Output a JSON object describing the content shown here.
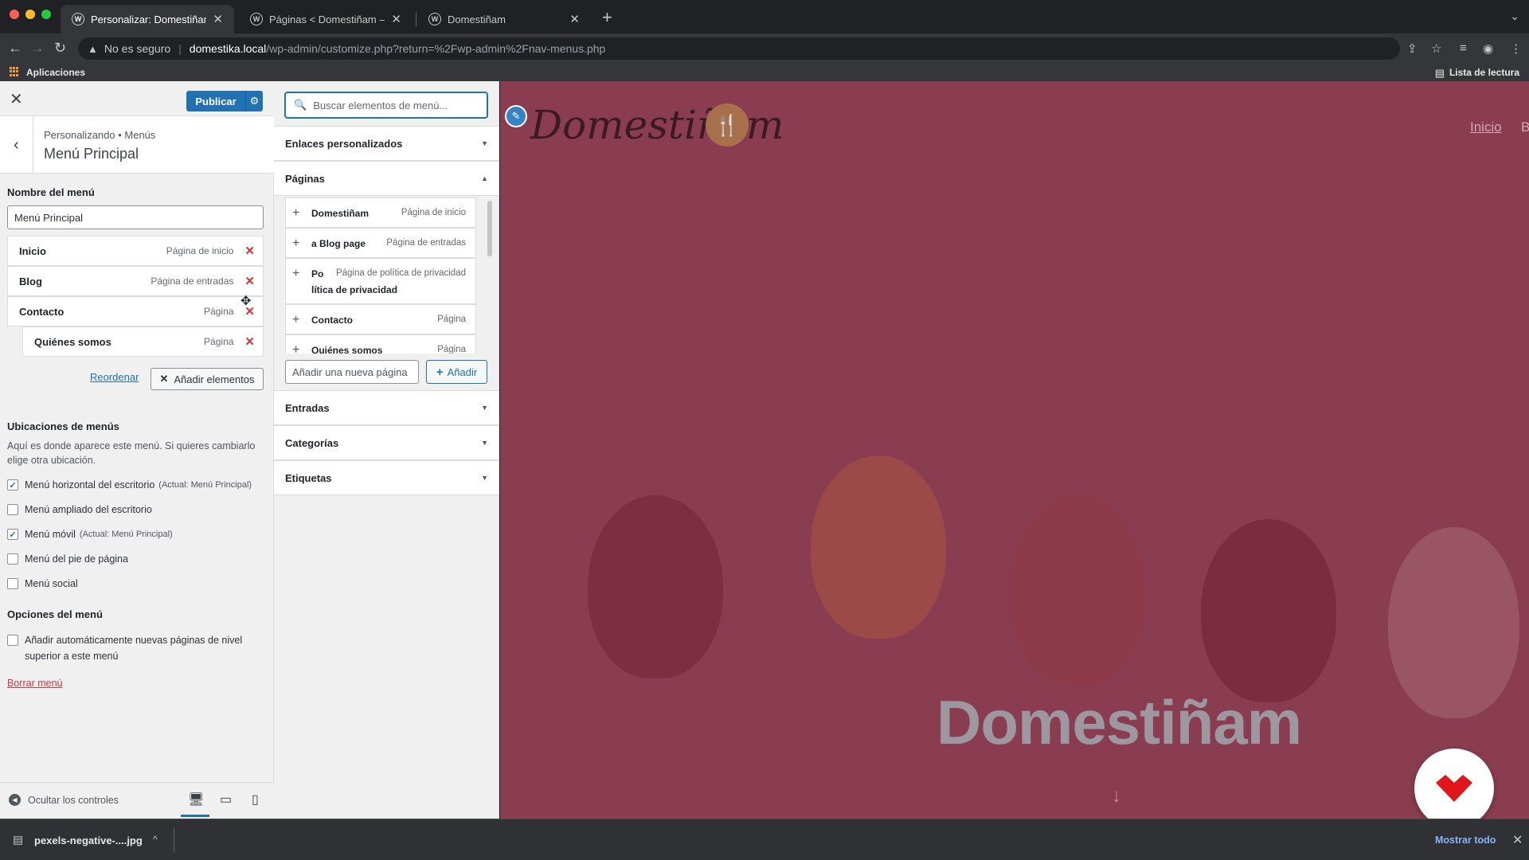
{
  "browser": {
    "tabs": [
      {
        "title": "Personalizar: Domestiñam",
        "active": true
      },
      {
        "title": "Páginas < Domestiñam — WordPress",
        "active": false
      },
      {
        "title": "Domestiñam",
        "active": false
      }
    ],
    "not_secure": "No es seguro",
    "url_host": "domestika.local",
    "url_path": "/wp-admin/customize.php?return=%2Fwp-admin%2Fnav-menus.php",
    "bookmarks_apps": "Aplicaciones",
    "reading_list": "Lista de lectura"
  },
  "customizer": {
    "publish_label": "Publicar",
    "breadcrumb": "Personalizando • Menús",
    "section_title": "Menú Principal",
    "menu_name_label": "Nombre del menú",
    "menu_name_value": "Menú Principal",
    "menu_items": [
      {
        "name": "Inicio",
        "type": "Página de inicio"
      },
      {
        "name": "Blog",
        "type": "Página de entradas"
      },
      {
        "name": "Contacto",
        "type": "Página"
      },
      {
        "name": "Quiénes somos",
        "type": "Página"
      }
    ],
    "reorder_label": "Reordenar",
    "add_items_label": "Añadir elementos",
    "locations_title": "Ubicaciones de menús",
    "locations_desc": "Aquí es donde aparece este menú. Si quieres cambiarlo elige otra ubicación.",
    "locations": [
      {
        "label": "Menú horizontal del escritorio",
        "note": "(Actual: Menú Principal)",
        "checked": true
      },
      {
        "label": "Menú ampliado del escritorio",
        "note": "",
        "checked": false
      },
      {
        "label": "Menú móvil",
        "note": "(Actual: Menú Principal)",
        "checked": true
      },
      {
        "label": "Menú del pie de página",
        "note": "",
        "checked": false
      },
      {
        "label": "Menú social",
        "note": "",
        "checked": false
      }
    ],
    "options_title": "Opciones del menú",
    "auto_add_line1": "Añadir automáticamente nuevas páginas de nivel",
    "auto_add_line2": "superior a este menú",
    "delete_menu": "Borrar menú",
    "hide_controls": "Ocultar los controles"
  },
  "available_items": {
    "search_placeholder": "Buscar elementos de menú...",
    "sections": {
      "custom_links": "Enlaces personalizados",
      "pages": "Páginas",
      "posts": "Entradas",
      "categories": "Categorías",
      "tags": "Etiquetas"
    },
    "pages": [
      {
        "name": "Domestiñam",
        "type": "Página de inicio"
      },
      {
        "name": "a Blog page",
        "type": "Página de entradas"
      },
      {
        "name": "Po",
        "type": "Página de política de privacidad",
        "name_cont": "lítica de privacidad"
      },
      {
        "name": "Contacto",
        "type": "Página"
      },
      {
        "name": "Quiénes somos",
        "type": "Página"
      }
    ],
    "new_page_placeholder": "Añadir una nueva página",
    "add_label": "Añadir"
  },
  "preview": {
    "site_logo": "Domestiñam",
    "nav_home": "Inicio",
    "nav_next": "B",
    "hero_title": "Domestiñam",
    "bg_color": "#8a3d51"
  },
  "downloads": {
    "file_name": "pexels-negative-....jpg",
    "show_all": "Mostrar todo"
  }
}
